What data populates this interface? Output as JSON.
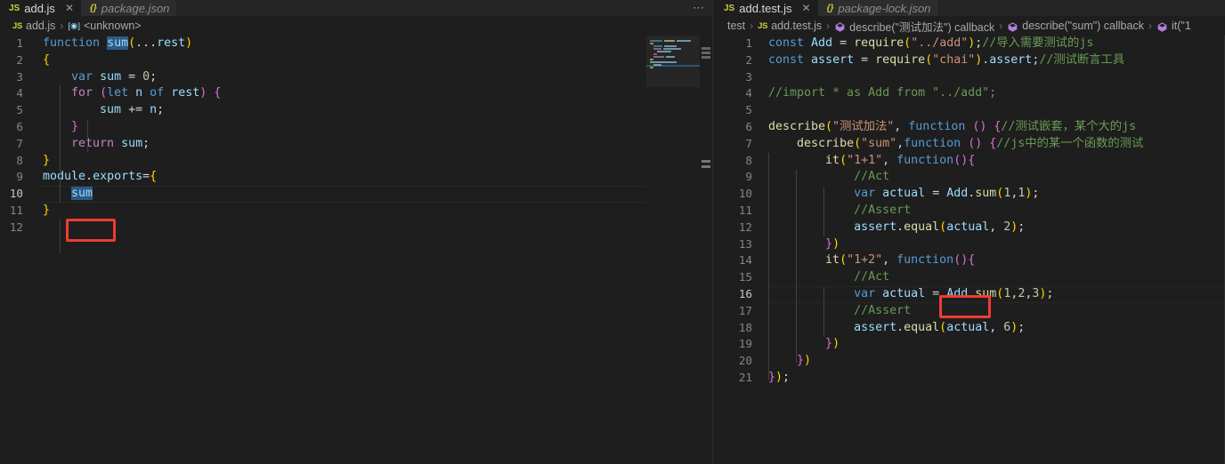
{
  "theme": {
    "editor_bg": "#1e1e1e",
    "tab_inactive_bg": "#2d2d2d",
    "tabbar_bg": "#252526",
    "annotation_red": "#f03c2e",
    "selection_blue": "#2b5a87",
    "line_number": "#858585"
  },
  "left_group": {
    "tabs": [
      {
        "label": "add.js",
        "icon": "js-file-icon",
        "active": true,
        "close": "✕"
      },
      {
        "label": "package.json",
        "icon": "json-file-icon",
        "active": false,
        "close": ""
      }
    ],
    "more_actions": "⋯",
    "breadcrumb": [
      {
        "label": "add.js",
        "icon": "js-file-icon"
      },
      {
        "label": "<unknown>",
        "icon": "namespace-symbol-icon"
      }
    ],
    "lines": [
      {
        "n": "1",
        "text": "function sum(...rest)"
      },
      {
        "n": "2",
        "text": "{"
      },
      {
        "n": "3",
        "text": "    var sum = 0;"
      },
      {
        "n": "4",
        "text": "    for (let n of rest) {"
      },
      {
        "n": "5",
        "text": "        sum += n;"
      },
      {
        "n": "6",
        "text": "    }"
      },
      {
        "n": "7",
        "text": "    return sum;"
      },
      {
        "n": "8",
        "text": "}"
      },
      {
        "n": "9",
        "text": "module.exports={"
      },
      {
        "n": "10",
        "text": "    sum"
      },
      {
        "n": "11",
        "text": "}"
      },
      {
        "n": "12",
        "text": ""
      }
    ],
    "current_line": "10",
    "highlight_token": "sum",
    "annotation": "red-box-around-sum-export"
  },
  "right_group": {
    "tabs": [
      {
        "label": "add.test.js",
        "icon": "js-file-icon",
        "active": true,
        "close": "✕"
      },
      {
        "label": "package-lock.json",
        "icon": "json-file-icon",
        "active": false,
        "close": ""
      }
    ],
    "breadcrumb": [
      {
        "label": "test",
        "icon": ""
      },
      {
        "label": "add.test.js",
        "icon": "js-file-icon"
      },
      {
        "label": "describe(\"测试加法\") callback",
        "icon": "method-symbol-icon"
      },
      {
        "label": "describe(\"sum\") callback",
        "icon": "method-symbol-icon"
      },
      {
        "label": "it(\"1",
        "icon": "method-symbol-icon"
      }
    ],
    "lines": [
      {
        "n": "1",
        "text": "const Add = require(\"../add\");//导入需要测试的js"
      },
      {
        "n": "2",
        "text": "const assert = require(\"chai\").assert;//测试断言工具"
      },
      {
        "n": "3",
        "text": ""
      },
      {
        "n": "4",
        "text": "//import * as Add from \"../add\";"
      },
      {
        "n": "5",
        "text": ""
      },
      {
        "n": "6",
        "text": "describe(\"测试加法\", function () {//测试嵌套，某个大的js"
      },
      {
        "n": "7",
        "text": "    describe(\"sum\",function () {//js中的某一个函数的测试"
      },
      {
        "n": "8",
        "text": "        it(\"1+1\", function(){"
      },
      {
        "n": "9",
        "text": "            //Act"
      },
      {
        "n": "10",
        "text": "            var actual = Add.sum(1,1);"
      },
      {
        "n": "11",
        "text": "            //Assert"
      },
      {
        "n": "12",
        "text": "            assert.equal(actual, 2);"
      },
      {
        "n": "13",
        "text": "        })"
      },
      {
        "n": "14",
        "text": "        it(\"1+2\", function(){"
      },
      {
        "n": "15",
        "text": "            //Act"
      },
      {
        "n": "16",
        "text": "            var actual = Add.sum(1,2,3);"
      },
      {
        "n": "17",
        "text": "            //Assert"
      },
      {
        "n": "18",
        "text": "            assert.equal(actual, 6);"
      },
      {
        "n": "19",
        "text": "        })"
      },
      {
        "n": "20",
        "text": "    })"
      },
      {
        "n": "21",
        "text": "});"
      }
    ],
    "current_line": "16",
    "annotation": "red-box-around-Add.sum-call"
  }
}
